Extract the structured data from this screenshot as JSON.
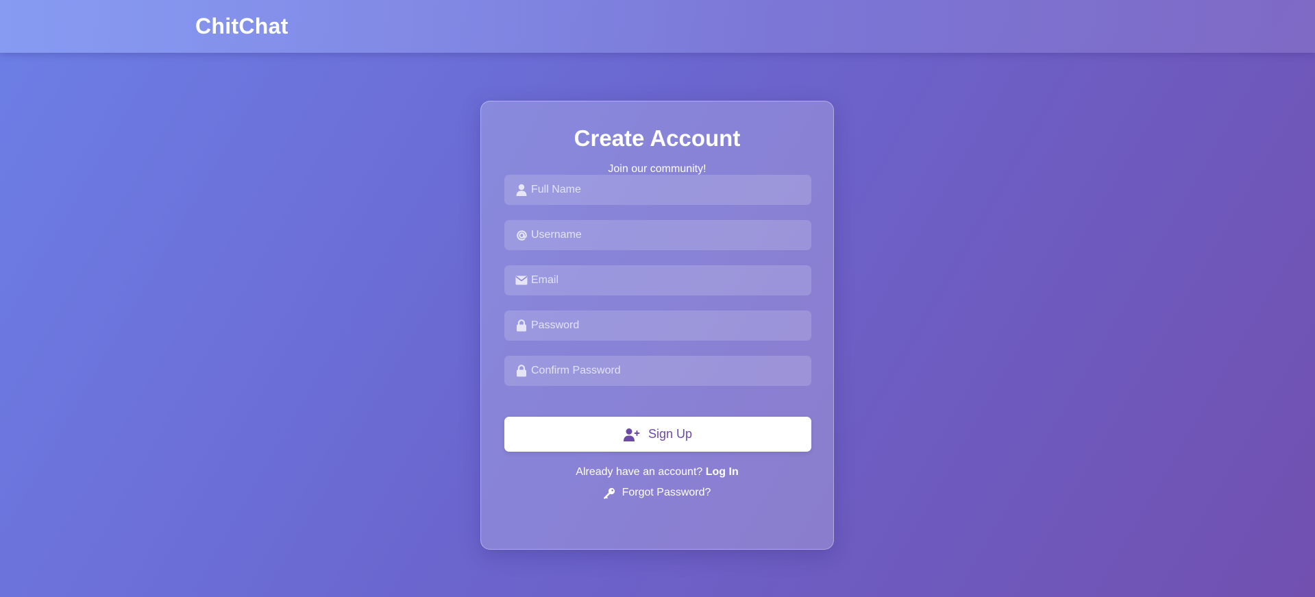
{
  "header": {
    "brand": "ChitChat"
  },
  "card": {
    "title": "Create Account",
    "subtitle": "Join our community!",
    "fields": [
      {
        "icon": "user-icon",
        "placeholder": "Full Name",
        "value": ""
      },
      {
        "icon": "at-icon",
        "placeholder": "Username",
        "value": ""
      },
      {
        "icon": "envelope-icon",
        "placeholder": "Email",
        "value": ""
      },
      {
        "icon": "lock-icon",
        "placeholder": "Password",
        "value": ""
      },
      {
        "icon": "lock-icon",
        "placeholder": "Confirm Password",
        "value": ""
      }
    ],
    "signup_button": {
      "icon": "user-plus-icon",
      "label": "Sign Up"
    },
    "login_prompt": "Already have an account?",
    "login_link": "Log In",
    "forgot": {
      "icon": "key-icon",
      "label": "Forgot Password?"
    }
  },
  "colors": {
    "accent": "#6b4aa8",
    "background_start": "#6c7fe6",
    "background_end": "#7150b0"
  }
}
